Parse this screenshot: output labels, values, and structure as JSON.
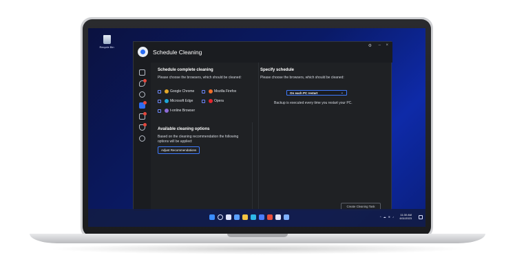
{
  "desktop": {
    "recycle_bin_label": "Recycle Bin"
  },
  "app": {
    "title": "Schedule Cleaning",
    "window_controls": {
      "settings_icon": "gear-icon",
      "minimize": "–",
      "close": "×"
    },
    "sidebar_icons": [
      "grid-icon",
      "broom-icon",
      "globe-icon",
      "calendar-icon",
      "shield-icon",
      "shield-badge-icon",
      "settings-icon"
    ],
    "left": {
      "heading": "Schedule complete cleaning",
      "description": "Please choose the browsers, which should be cleaned:",
      "browsers": [
        {
          "label": "Google Chrome",
          "color": "#e2a82b"
        },
        {
          "label": "Mozilla Firefox",
          "color": "#f06d2a"
        },
        {
          "label": "Microsoft Edge",
          "color": "#1fa5d8"
        },
        {
          "label": "Opera",
          "color": "#e3262e"
        },
        {
          "label": "t-online Browser",
          "color": "#8d6bd8"
        }
      ],
      "options_heading": "Available cleaning options",
      "options_description": "Based on the cleaning recommendation the following options will be applied:",
      "adjust_button": "Adjust Recommendations"
    },
    "right": {
      "heading": "Specify schedule",
      "description": "Please choose the browsers, which should be cleaned:",
      "schedule_select": "On each PC restart",
      "note": "Backup is executed every time you restart your PC."
    },
    "create_button": "Create Cleaning Task"
  },
  "taskbar": {
    "time": "11:30 AM",
    "date": "6/11/2023",
    "accent": "#2f6cf0"
  }
}
